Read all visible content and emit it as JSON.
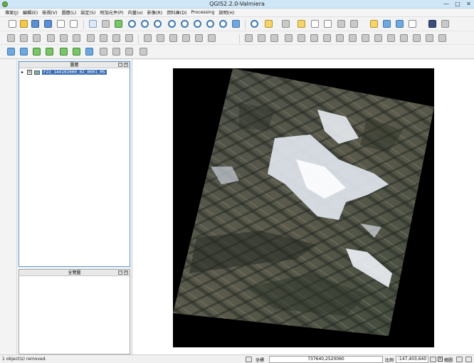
{
  "window": {
    "title": "QGIS2.2.0-Valmiera",
    "minimize_glyph": "—",
    "maximize_glyph": "□",
    "close_glyph": "✕"
  },
  "menubar": {
    "items": [
      "專案(J)",
      "編輯(E)",
      "檢視(V)",
      "圖層(L)",
      "設定(S)",
      "附加元件(P)",
      "向量(o)",
      "影像(R)",
      "資料庫(D)",
      "Processing",
      "說明(H)"
    ]
  },
  "layers_panel": {
    "title": "圖層",
    "float_glyph": "▭",
    "close_glyph": "×",
    "layer": {
      "expand_glyph": "▸",
      "check_glyph": "×",
      "name": "F22_144102000_02_0001_MS"
    }
  },
  "overview_panel": {
    "title": "全覽圖",
    "float_glyph": "▭",
    "close_glyph": "×"
  },
  "statusbar": {
    "message": "1 object(s) removed.",
    "coordinate_label": "坐標",
    "coordinate_value": "737640,2520060",
    "scale_label": "比例",
    "scale_value": ":147,403,640",
    "render_check_glyph": "×",
    "render_label": "繪圖"
  },
  "colors": {
    "title_bar": "#cfe6f7",
    "layer_selection": "#3b6fb6",
    "map_background": "#000000"
  },
  "icons": {
    "toolbar_file": [
      "new-project-icon",
      "open-project-icon",
      "save-project-icon",
      "save-as-icon",
      "new-print-composer-icon",
      "composer-manager-icon"
    ],
    "toolbar_nav": [
      "pan-map-icon",
      "pan-to-selection-icon",
      "zoom-in-icon",
      "zoom-out-icon",
      "zoom-full-icon",
      "zoom-to-selection-icon",
      "zoom-to-layer-icon",
      "zoom-last-icon",
      "zoom-next-icon",
      "refresh-icon"
    ],
    "toolbar_attr": [
      "identify-icon",
      "select-icon",
      "deselect-icon",
      "attribute-table-icon",
      "field-calculator-icon",
      "measure-icon",
      "map-tips-icon",
      "new-bookmark-icon",
      "show-bookmarks-icon",
      "text-annotation-icon",
      "help-icon"
    ],
    "vertical": [
      "add-vector-layer-icon",
      "add-raster-layer-icon",
      "add-postgis-layer-icon",
      "add-spatialite-layer-icon",
      "add-mssql-layer-icon",
      "add-oracle-layer-icon",
      "add-wms-layer-icon",
      "add-wcs-layer-icon",
      "add-wfs-layer-icon",
      "add-delimited-text-icon",
      "new-shapefile-icon",
      "new-spatialite-icon",
      "new-gpx-icon",
      "remove-layer-icon",
      "gps-tools-icon",
      "road-graph-icon",
      "georeferencer-icon",
      "osm-icon"
    ]
  }
}
